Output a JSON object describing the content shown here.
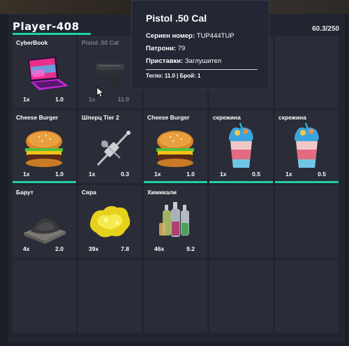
{
  "player": {
    "name": "Player-408",
    "weight": "60.3/250"
  },
  "slots": [
    {
      "name": "CyberBook",
      "count": "1x",
      "weight": "1.0",
      "icon": "laptop-icon"
    },
    {
      "name": "Pistol .50 Cal",
      "count": "1x",
      "weight": "11.0",
      "icon": "pistol-icon"
    },
    {
      "name": "Cheese Burger",
      "count": "1x",
      "weight": "1.0",
      "icon": "burger-icon"
    },
    {
      "name": "Шперц Tier 2",
      "count": "1x",
      "weight": "0.3",
      "icon": "lockpick-icon"
    },
    {
      "name": "Cheese Burger",
      "count": "1x",
      "weight": "1.0",
      "icon": "burger-icon"
    },
    {
      "name": "скрежина",
      "count": "1x",
      "weight": "0.5",
      "icon": "smoothie-icon"
    },
    {
      "name": "скрежина",
      "count": "1x",
      "weight": "0.5",
      "icon": "smoothie-icon"
    },
    {
      "name": "Барут",
      "count": "4x",
      "weight": "2.0",
      "icon": "gunpowder-icon"
    },
    {
      "name": "Сяра",
      "count": "39x",
      "weight": "7.8",
      "icon": "sulfur-icon"
    },
    {
      "name": "Химикали",
      "count": "46x",
      "weight": "9.2",
      "icon": "chemicals-icon"
    }
  ],
  "tooltip": {
    "title": "Pistol .50 Cal",
    "serial_label": "Сериен номер:",
    "serial_value": " TUP444TUP",
    "ammo_label": "Патрони:",
    "ammo_value": " 79",
    "attach_label": "Приставки:",
    "attach_value": " Заглушител",
    "footer": "Тегло: 11.0 | Брой: 1"
  },
  "colors": {
    "accent": "#1fd1a8",
    "slot": "#2a2d38",
    "panel": "#22252f"
  }
}
